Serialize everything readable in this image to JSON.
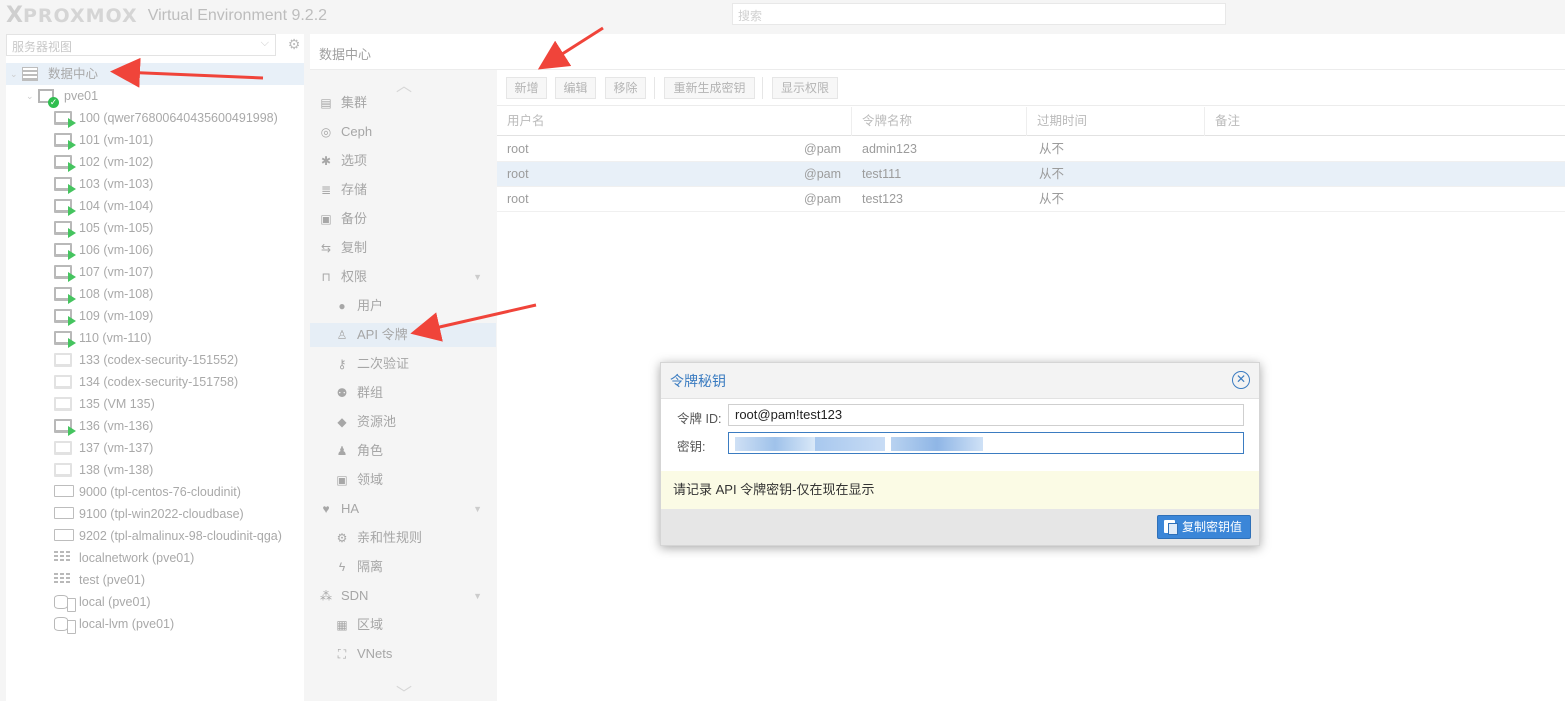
{
  "header": {
    "logo_x": "X",
    "logo_text": "PROXMOX",
    "version": "Virtual Environment 9.2.2",
    "search_placeholder": "搜索"
  },
  "left": {
    "view_select": "服务器视图",
    "tree": [
      {
        "label": "数据中心",
        "type": "datacenter"
      },
      {
        "label": "pve01",
        "type": "node"
      },
      {
        "label": "100 (qwer76800640435600491998)",
        "type": "vm-run"
      },
      {
        "label": "101 (vm-101)",
        "type": "vm-run"
      },
      {
        "label": "102 (vm-102)",
        "type": "vm-run"
      },
      {
        "label": "103 (vm-103)",
        "type": "vm-run"
      },
      {
        "label": "104 (vm-104)",
        "type": "vm-run"
      },
      {
        "label": "105 (vm-105)",
        "type": "vm-run"
      },
      {
        "label": "106 (vm-106)",
        "type": "vm-run"
      },
      {
        "label": "107 (vm-107)",
        "type": "vm-run"
      },
      {
        "label": "108 (vm-108)",
        "type": "vm-run"
      },
      {
        "label": "109 (vm-109)",
        "type": "vm-run"
      },
      {
        "label": "110 (vm-110)",
        "type": "vm-run"
      },
      {
        "label": "133 (codex-security-151552)",
        "type": "vm-off"
      },
      {
        "label": "134 (codex-security-151758)",
        "type": "vm-off"
      },
      {
        "label": "135 (VM 135)",
        "type": "vm-off"
      },
      {
        "label": "136 (vm-136)",
        "type": "vm-run"
      },
      {
        "label": "137 (vm-137)",
        "type": "vm-off"
      },
      {
        "label": "138 (vm-138)",
        "type": "vm-off"
      },
      {
        "label": "9000 (tpl-centos-76-cloudinit)",
        "type": "template"
      },
      {
        "label": "9100 (tpl-win2022-cloudbase)",
        "type": "template"
      },
      {
        "label": "9202 (tpl-almalinux-98-cloudinit-qga)",
        "type": "template"
      },
      {
        "label": "localnetwork (pve01)",
        "type": "network"
      },
      {
        "label": "test (pve01)",
        "type": "network"
      },
      {
        "label": "local (pve01)",
        "type": "storage"
      },
      {
        "label": "local-lvm (pve01)",
        "type": "storage"
      }
    ]
  },
  "main": {
    "title": "数据中心",
    "nav": [
      {
        "label": "集群",
        "icon": "server-icon",
        "glyph": "▤",
        "sub": false
      },
      {
        "label": "Ceph",
        "icon": "ceph-icon",
        "glyph": "◎",
        "sub": false
      },
      {
        "label": "选项",
        "icon": "gear-icon",
        "glyph": "✱",
        "sub": false
      },
      {
        "label": "存储",
        "icon": "database-icon",
        "glyph": "≣",
        "sub": false
      },
      {
        "label": "备份",
        "icon": "floppy-icon",
        "glyph": "▣",
        "sub": false
      },
      {
        "label": "复制",
        "icon": "retweet-icon",
        "glyph": "⇆",
        "sub": false
      },
      {
        "label": "权限",
        "icon": "unlock-icon",
        "glyph": "⊓",
        "sub": false,
        "collapsible": true
      },
      {
        "label": "用户",
        "icon": "user-icon",
        "glyph": "●",
        "sub": true
      },
      {
        "label": "API 令牌",
        "icon": "user-outline-icon",
        "glyph": "♙",
        "sub": true,
        "active": true
      },
      {
        "label": "二次验证",
        "icon": "key-icon",
        "glyph": "⚷",
        "sub": true
      },
      {
        "label": "群组",
        "icon": "users-icon",
        "glyph": "⚉",
        "sub": true
      },
      {
        "label": "资源池",
        "icon": "tags-icon",
        "glyph": "◆",
        "sub": true
      },
      {
        "label": "角色",
        "icon": "male-icon",
        "glyph": "♟",
        "sub": true
      },
      {
        "label": "领域",
        "icon": "address-book-icon",
        "glyph": "▣",
        "sub": true
      },
      {
        "label": "HA",
        "icon": "heartbeat-icon",
        "glyph": "♥",
        "sub": false,
        "collapsible": true
      },
      {
        "label": "亲和性规则",
        "icon": "cogs-icon",
        "glyph": "⚙",
        "sub": true
      },
      {
        "label": "隔离",
        "icon": "bolt-icon",
        "glyph": "ϟ",
        "sub": true
      },
      {
        "label": "SDN",
        "icon": "sdn-icon",
        "glyph": "⁂",
        "sub": false,
        "collapsible": true
      },
      {
        "label": "区域",
        "icon": "th-icon",
        "glyph": "▦",
        "sub": true
      },
      {
        "label": "VNets",
        "icon": "network-icon",
        "glyph": "⛶",
        "sub": true
      }
    ],
    "toolbar": {
      "add": "新增",
      "edit": "编辑",
      "remove": "移除",
      "regen": "重新生成密钥",
      "show_perm": "显示权限"
    },
    "grid": {
      "columns": [
        "用户名",
        "令牌名称",
        "过期时间",
        "备注"
      ],
      "rows": [
        {
          "user": "root",
          "realm": "@pam",
          "token": "admin123",
          "expire": "从不",
          "comment": ""
        },
        {
          "user": "root",
          "realm": "@pam",
          "token": "test111",
          "expire": "从不",
          "comment": ""
        },
        {
          "user": "root",
          "realm": "@pam",
          "token": "test123",
          "expire": "从不",
          "comment": ""
        }
      ]
    }
  },
  "dialog": {
    "title": "令牌秘钥",
    "token_id_label": "令牌 ID:",
    "token_id_value": "root@pam!test123",
    "secret_label": "密钥:",
    "note": "请记录 API 令牌密钥-仅在现在显示",
    "copy_button": "复制密钥值"
  },
  "colors": {
    "accent": "#3b7cc1",
    "button": "#3b86d8",
    "arrow": "#f0443a",
    "running": "#45c45f",
    "note_bg": "#fbfbe5"
  }
}
